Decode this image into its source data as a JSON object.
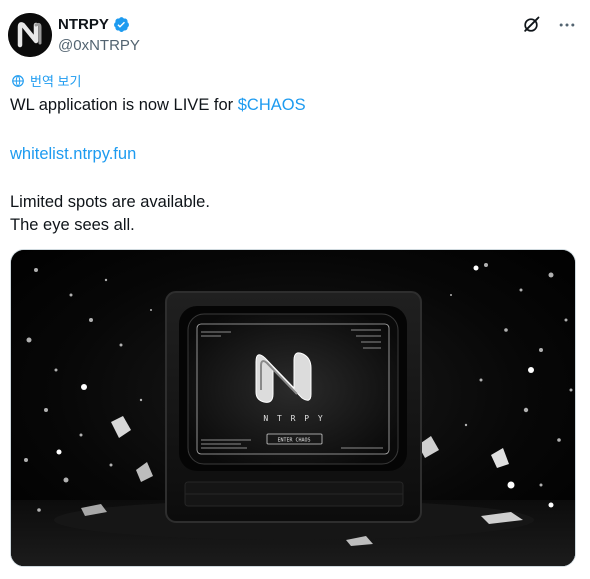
{
  "author": {
    "display_name": "NTRPY",
    "handle": "@0xNTRPY",
    "verified": true,
    "avatar_icon": "ntrpy-logo-icon"
  },
  "header_actions": {
    "grok_icon": "grok-slash-icon",
    "more_icon": "more-dots-icon"
  },
  "translate": {
    "label": "번역 보기",
    "icon": "globe-icon"
  },
  "tweet": {
    "line1_prefix": "WL application is now LIVE for ",
    "cashtag": "$CHAOS",
    "link": "whitelist.ntrpy.fun",
    "line3": "Limited spots are available.",
    "line4": "The eye sees all."
  },
  "media": {
    "screen_logo_text": "N T R P Y",
    "screen_button": "ENTER CHAOS"
  },
  "colors": {
    "link": "#1d9bf0",
    "text": "#0f1419",
    "secondary": "#536471",
    "verified": "#1d9bf0"
  }
}
